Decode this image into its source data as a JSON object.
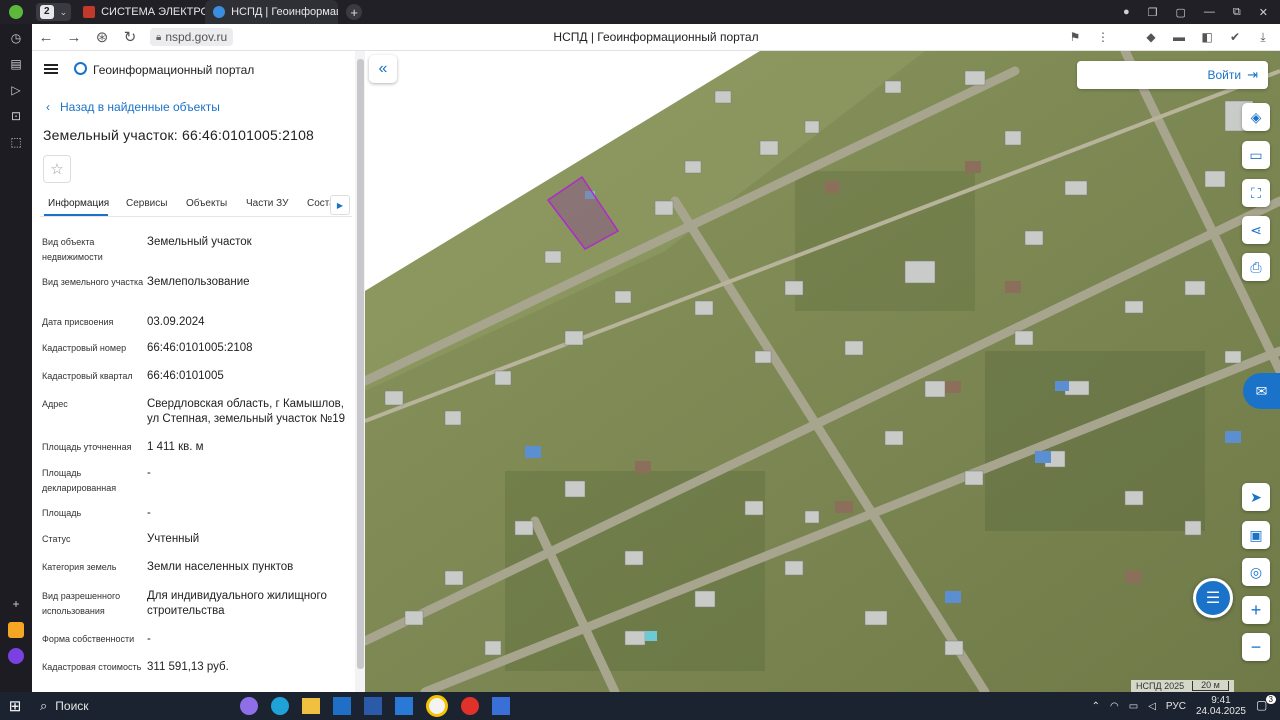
{
  "browser": {
    "tab_count": "2",
    "tabs": [
      {
        "label": "СИСТЕМА ЭЛЕКТРОННО"
      },
      {
        "label": "НСПД | Геоинформаци"
      }
    ],
    "url": "nspd.gov.ru",
    "page_title": "НСПД | Геоинформационный портал"
  },
  "panel": {
    "header_title": "Геоинформационный портал",
    "back_link": "Назад в найденные объекты",
    "object_title": "Земельный участок: 66:46:0101005:2108",
    "tabs": [
      {
        "label": "Информация"
      },
      {
        "label": "Сервисы"
      },
      {
        "label": "Объекты"
      },
      {
        "label": "Части ЗУ"
      },
      {
        "label": "Соста"
      }
    ],
    "attributes": [
      {
        "label": "Вид объекта недвижимости",
        "value": "Земельный участок"
      },
      {
        "label": "Вид земельного участка",
        "value": "Землепользование"
      },
      {
        "label": "Дата присвоения",
        "value": "03.09.2024"
      },
      {
        "label": "Кадастровый номер",
        "value": "66:46:0101005:2108"
      },
      {
        "label": "Кадастровый квартал",
        "value": "66:46:0101005"
      },
      {
        "label": "Адрес",
        "value": "Свердловская область, г Камышлов, ул Степная, земельный участок №19"
      },
      {
        "label": "Площадь уточненная",
        "value": "1 411 кв. м"
      },
      {
        "label": "Площадь декларированная",
        "value": "-"
      },
      {
        "label": "Площадь",
        "value": "-"
      },
      {
        "label": "Статус",
        "value": "Учтенный"
      },
      {
        "label": "Категория земель",
        "value": "Земли населенных пунктов"
      },
      {
        "label": "Вид разрешенного использования",
        "value": "Для индивидуального жилищного строительства"
      },
      {
        "label": "Форма собственности",
        "value": "-"
      },
      {
        "label": "Кадастровая стоимость",
        "value": "311 591,13 руб."
      }
    ]
  },
  "map": {
    "login_label": "Войти",
    "copyright": "НСПД 2025",
    "scale_label": "20 м"
  },
  "taskbar": {
    "search_label": "Поиск",
    "lang": "РУС",
    "time": "9:41",
    "date": "24.04.2025",
    "notifications": "3"
  },
  "colors": {
    "accent": "#1a73c8",
    "parcel_outline": "#b02ac8",
    "map_vegetation": "#6f7d4a"
  }
}
